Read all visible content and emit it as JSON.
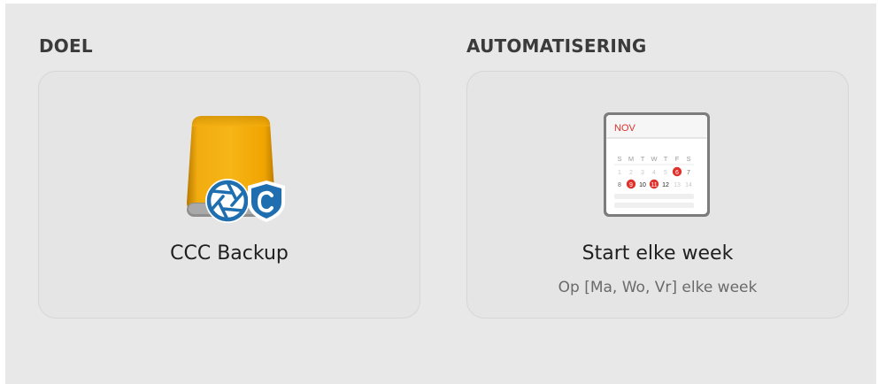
{
  "sections": {
    "destination": {
      "title": "DOEL",
      "card_label": "CCC Backup",
      "icon": "external-drive-icon"
    },
    "automation": {
      "title": "AUTOMATISERING",
      "card_label": "Start elke week",
      "card_sub": "Op [Ma, Wo, Vr] elke week",
      "icon": "calendar-icon",
      "calendar": {
        "month": "NOV",
        "weekdays": [
          "S",
          "M",
          "T",
          "W",
          "T",
          "F",
          "S"
        ],
        "row1": [
          "1",
          "2",
          "3",
          "4",
          "5",
          "6",
          "7"
        ],
        "row2": [
          "8",
          "9",
          "10",
          "11",
          "12",
          "13",
          "14"
        ]
      }
    }
  },
  "colors": {
    "panel_bg": "#e8e8e8",
    "drive_gold": "#f0a500",
    "ccc_blue": "#1f6fb0",
    "calendar_red": "#e0322c"
  }
}
